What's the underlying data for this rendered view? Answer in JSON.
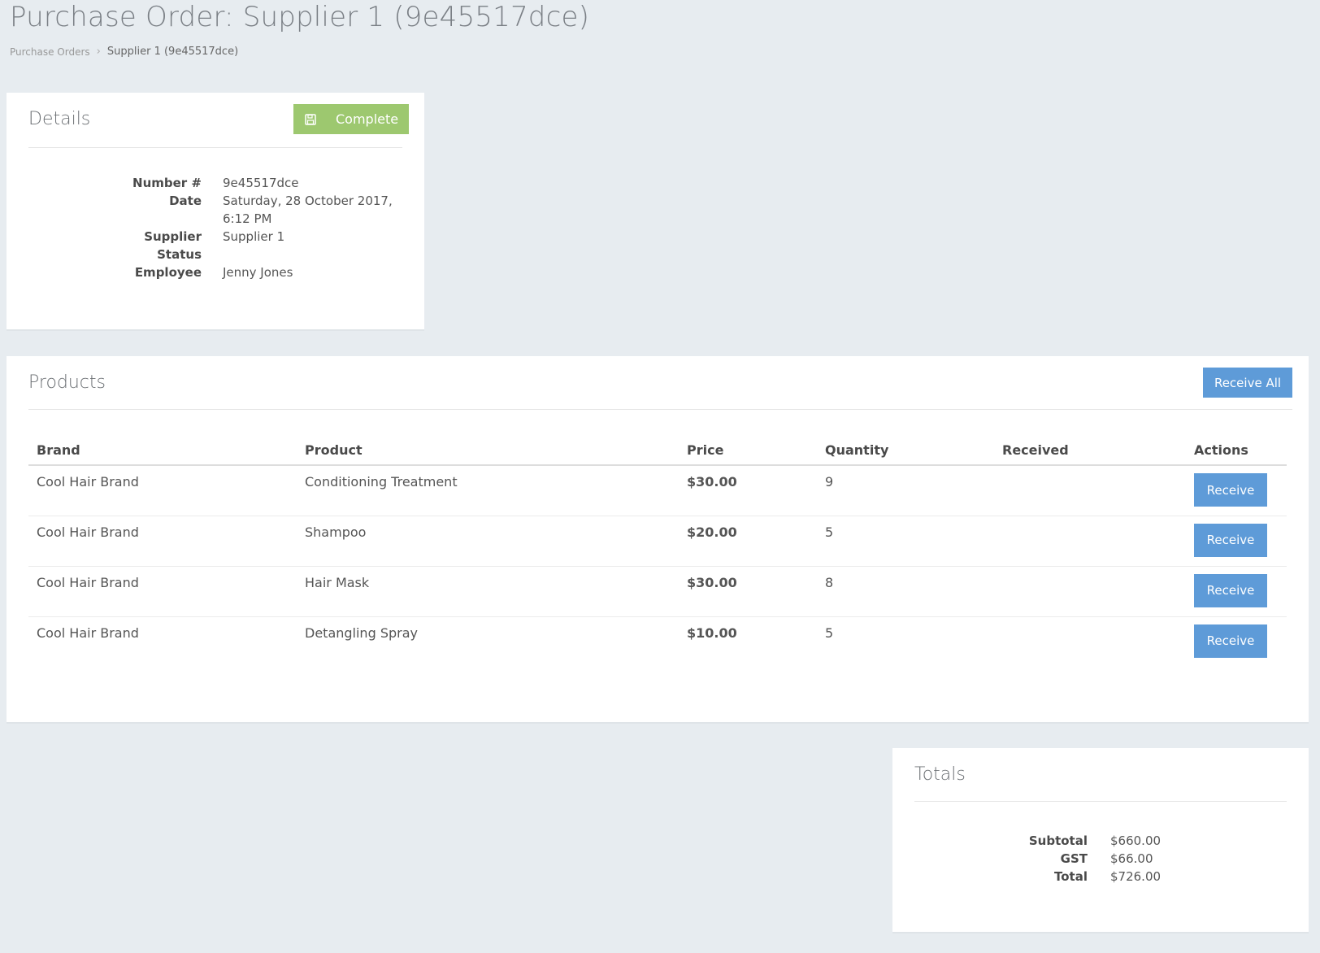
{
  "page": {
    "title": "Purchase Order: Supplier 1 (9e45517dce)"
  },
  "breadcrumb": {
    "parent": "Purchase Orders",
    "separator": "›",
    "current": "Supplier 1 (9e45517dce)"
  },
  "details": {
    "title": "Details",
    "complete_label": "Complete",
    "complete_icon": "save-icon",
    "fields": [
      {
        "key": "Number #",
        "value": "9e45517dce"
      },
      {
        "key": "Date",
        "value": "Saturday, 28 October 2017, 6:12 PM"
      },
      {
        "key": "Supplier",
        "value": "Supplier 1"
      },
      {
        "key": "Status",
        "value": ""
      },
      {
        "key": "Employee",
        "value": "Jenny Jones"
      }
    ]
  },
  "products": {
    "title": "Products",
    "receive_all_label": "Receive All",
    "columns": [
      "Brand",
      "Product",
      "Price",
      "Quantity",
      "Received",
      "Actions"
    ],
    "rows": [
      {
        "brand": "Cool Hair Brand",
        "product": "Conditioning Treatment",
        "price": "$30.00",
        "quantity": "9",
        "received": "",
        "action": "Receive"
      },
      {
        "brand": "Cool Hair Brand",
        "product": "Shampoo",
        "price": "$20.00",
        "quantity": "5",
        "received": "",
        "action": "Receive"
      },
      {
        "brand": "Cool Hair Brand",
        "product": "Hair Mask",
        "price": "$30.00",
        "quantity": "8",
        "received": "",
        "action": "Receive"
      },
      {
        "brand": "Cool Hair Brand",
        "product": "Detangling Spray",
        "price": "$10.00",
        "quantity": "5",
        "received": "",
        "action": "Receive"
      }
    ]
  },
  "totals": {
    "title": "Totals",
    "fields": [
      {
        "key": "Subtotal",
        "value": "$660.00"
      },
      {
        "key": "GST",
        "value": "$66.00"
      },
      {
        "key": "Total",
        "value": "$726.00"
      }
    ]
  },
  "colors": {
    "background": "#e7ecf0",
    "complete_button": "#9dc86f",
    "primary_button": "#5e9bd8"
  }
}
